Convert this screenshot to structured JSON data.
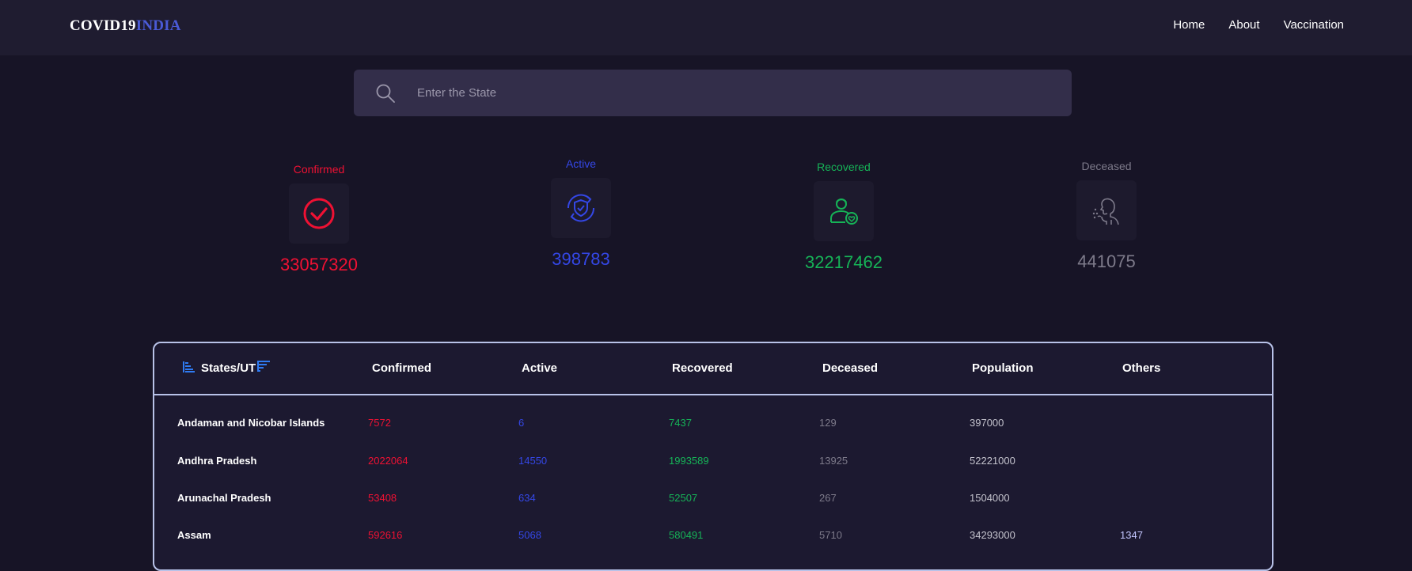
{
  "brand": {
    "name_main": "COVID19",
    "name_accent": "INDIA"
  },
  "nav": {
    "home": "Home",
    "about": "About",
    "vaccination": "Vaccination"
  },
  "search": {
    "placeholder": "Enter the State",
    "value": ""
  },
  "stats": {
    "confirmed": {
      "label": "Confirmed",
      "value": "33057320",
      "color": "#ef1133"
    },
    "active": {
      "label": "Active",
      "value": "398783",
      "color": "#3447e6"
    },
    "recovered": {
      "label": "Recovered",
      "value": "32217462",
      "color": "#16b357"
    },
    "deceased": {
      "label": "Deceased",
      "value": "441075",
      "color": "#7d7a8a"
    }
  },
  "table": {
    "headers": {
      "state": "States/UT",
      "confirmed": "Confirmed",
      "active": "Active",
      "recovered": "Recovered",
      "deceased": "Deceased",
      "population": "Population",
      "others": "Others"
    },
    "rows": [
      {
        "state": "Andaman and Nicobar Islands",
        "confirmed": "7572",
        "active": "6",
        "recovered": "7437",
        "deceased": "129",
        "population": "397000",
        "others": ""
      },
      {
        "state": "Andhra Pradesh",
        "confirmed": "2022064",
        "active": "14550",
        "recovered": "1993589",
        "deceased": "13925",
        "population": "52221000",
        "others": ""
      },
      {
        "state": "Arunachal Pradesh",
        "confirmed": "53408",
        "active": "634",
        "recovered": "52507",
        "deceased": "267",
        "population": "1504000",
        "others": ""
      },
      {
        "state": "Assam",
        "confirmed": "592616",
        "active": "5068",
        "recovered": "580491",
        "deceased": "5710",
        "population": "34293000",
        "others": "1347"
      }
    ]
  }
}
